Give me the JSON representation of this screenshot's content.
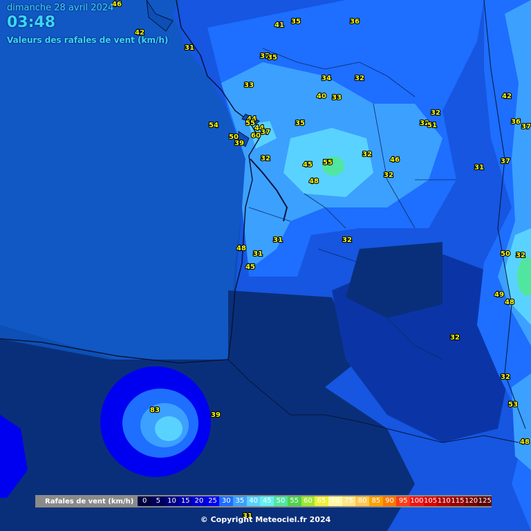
{
  "header": {
    "date": "dimanche 28 avril 2024",
    "time": "03:48",
    "subtitle": "Valeurs des rafales de vent (km/h)"
  },
  "legend": {
    "title": "Rafales de vent (km/h)",
    "steps": [
      {
        "label": "0",
        "color": "#000040"
      },
      {
        "label": "5",
        "color": "#00005a"
      },
      {
        "label": "10",
        "color": "#000080"
      },
      {
        "label": "15",
        "color": "#0000a8"
      },
      {
        "label": "20",
        "color": "#0000d2"
      },
      {
        "label": "25",
        "color": "#0000f0"
      },
      {
        "label": "30",
        "color": "#1e6eff"
      },
      {
        "label": "35",
        "color": "#3ca0ff"
      },
      {
        "label": "40",
        "color": "#5ad2ff"
      },
      {
        "label": "45",
        "color": "#64f0f0"
      },
      {
        "label": "50",
        "color": "#50e6a0"
      },
      {
        "label": "55",
        "color": "#50d250"
      },
      {
        "label": "60",
        "color": "#a0e632"
      },
      {
        "label": "65",
        "color": "#f0f03c"
      },
      {
        "label": "70",
        "color": "#fffaa0"
      },
      {
        "label": "75",
        "color": "#ffe682"
      },
      {
        "label": "80",
        "color": "#ffc850"
      },
      {
        "label": "85",
        "color": "#ffa000"
      },
      {
        "label": "90",
        "color": "#ff7800"
      },
      {
        "label": "95",
        "color": "#ff3c14"
      },
      {
        "label": "100",
        "color": "#f01414"
      },
      {
        "label": "105",
        "color": "#dc0000"
      },
      {
        "label": "110",
        "color": "#b40000"
      },
      {
        "label": "115",
        "color": "#960000"
      },
      {
        "label": "120",
        "color": "#780000"
      },
      {
        "label": "125",
        "color": "#5a0000"
      }
    ]
  },
  "copyright": "© Copyright Meteociel.fr 2024",
  "stations": [
    "46",
    "42",
    "31",
    "41",
    "35",
    "36",
    "37",
    "35",
    "34",
    "32",
    "33",
    "40",
    "33",
    "42",
    "54",
    "44",
    "55",
    "44",
    "37",
    "35",
    "32",
    "32",
    "51",
    "36",
    "37",
    "50",
    "60",
    "39",
    "32",
    "45",
    "55",
    "32",
    "46",
    "48",
    "32",
    "31",
    "37",
    "31",
    "32",
    "48",
    "31",
    "45",
    "50",
    "32",
    "49",
    "48",
    "32",
    "32",
    "53",
    "48",
    "83",
    "39",
    "31"
  ],
  "colors": {
    "ocean_deep": "#0a3a8c",
    "ocean": "#0d4fb5",
    "land_base": "#1656e0",
    "gust_30": "#1e6eff",
    "gust_35": "#3ca0ff",
    "gust_40": "#5ad2ff",
    "gust_50": "#50e6a0",
    "inland_dark": "#0a2f7a",
    "accent_text": "#39d7ff",
    "value_text": "#ffff00"
  }
}
